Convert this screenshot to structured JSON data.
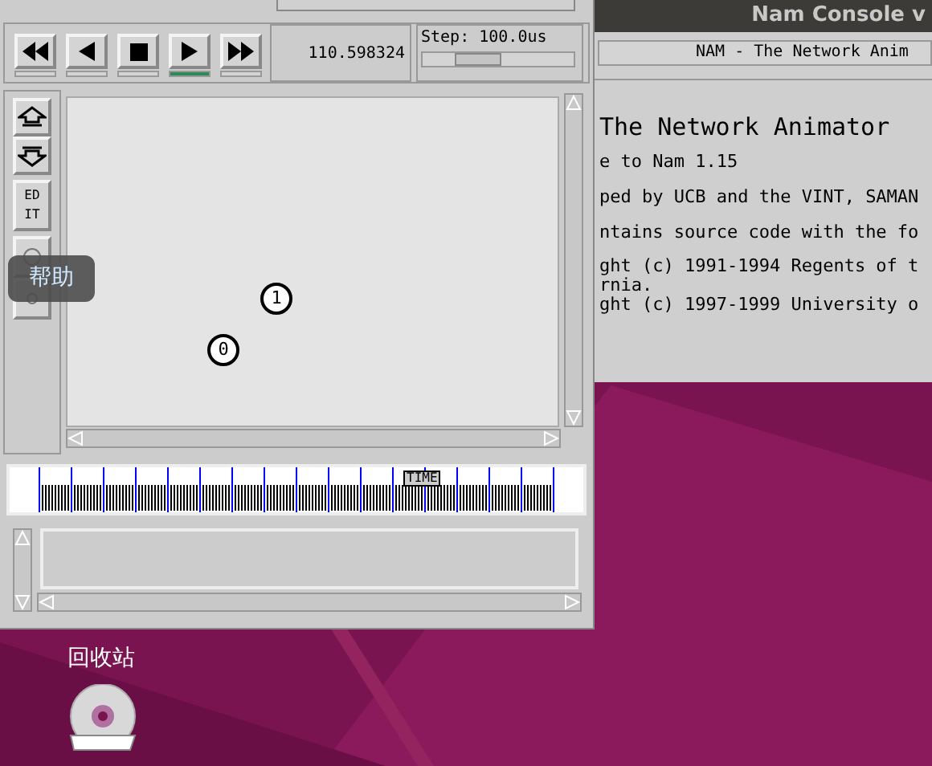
{
  "nam_window": {
    "transport": [
      {
        "kind": "rewind",
        "selected": false
      },
      {
        "kind": "back",
        "selected": false
      },
      {
        "kind": "stop",
        "selected": false
      },
      {
        "kind": "play",
        "selected": true
      },
      {
        "kind": "forward",
        "selected": false
      }
    ],
    "time": "110.598324",
    "step": {
      "label": "Step: 100.0us",
      "level": 0.3
    },
    "tools": [
      {
        "kind": "zoom_in"
      },
      {
        "kind": "zoom_out"
      },
      {
        "kind": "edit",
        "label": "EDIT"
      },
      {
        "kind": "big_dot"
      },
      {
        "kind": "small_dot"
      }
    ],
    "nodes": [
      {
        "label": "1"
      },
      {
        "label": "0"
      }
    ],
    "timeline": {
      "marker": "TIME",
      "level": 0.7
    }
  },
  "console_window": {
    "title": "Nam Console v",
    "header": "NAM - The Network Anim",
    "lines": [
      {
        "text": "The Network Animator",
        "kind": "heading"
      },
      {
        "text": "e to Nam 1.15",
        "kind": "body"
      },
      {
        "text": "ped by UCB and the VINT, SAMAN",
        "kind": "body"
      },
      {
        "text": "ntains source code with the fo",
        "kind": "body"
      },
      {
        "text": "ght (c) 1991-1994 Regents of t",
        "kind": "tight"
      },
      {
        "text": "rnia.",
        "kind": "tight"
      },
      {
        "text": "ght (c) 1997-1999 University o",
        "kind": "tight"
      }
    ]
  },
  "tooltip": "帮助",
  "desktop": {
    "labels": [
      "回收站"
    ]
  }
}
